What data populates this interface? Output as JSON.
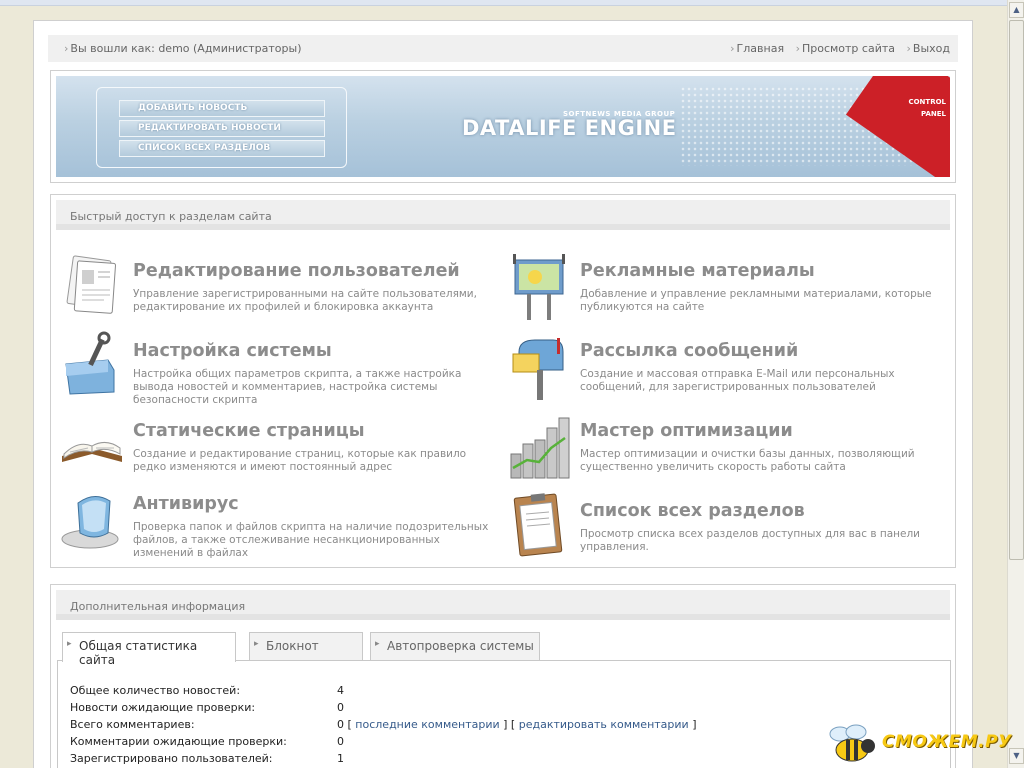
{
  "browser": {
    "scroll_up_icon": "arrow-up-icon",
    "scroll_down_icon": "arrow-down-icon"
  },
  "userbar": {
    "logged_in": "Вы вошли как: demo (Администраторы)",
    "links": [
      "Главная",
      "Просмотр сайта",
      "Выход"
    ]
  },
  "banner": {
    "menu": [
      "ДОБАВИТЬ НОВОСТЬ",
      "РЕДАКТИРОВАТЬ НОВОСТИ",
      "СПИСОК ВСЕХ РАЗДЕЛОВ"
    ],
    "group": "SOFTNEWS MEDIA GROUP",
    "brand": "DATALIFE ENGINE",
    "corner_line1": "CONTROL",
    "corner_line2": "PANEL"
  },
  "quick": {
    "heading": "Быстрый доступ к разделам сайта",
    "tiles": [
      {
        "title": "Редактирование пользователей",
        "desc": "Управление зарегистрированными на сайте пользователями, редактирование их профилей и блокировка аккаунта",
        "icon": "user-profile-icon"
      },
      {
        "title": "Рекламные материалы",
        "desc": "Добавление и управление рекламными материалами, которые публикуются на сайте",
        "icon": "billboard-icon"
      },
      {
        "title": "Настройка системы",
        "desc": "Настройка общих параметров скрипта, а также настройка вывода новостей и комментариев, настройка системы безопасности скрипта",
        "icon": "toolbox-icon"
      },
      {
        "title": "Рассылка сообщений",
        "desc": "Создание и массовая отправка E-Mail или персональных сообщений, для зарегистрированных пользователей",
        "icon": "mailbox-icon"
      },
      {
        "title": "Статические страницы",
        "desc": "Создание и редактирование страниц, которые как правило редко изменяются и имеют постоянный адрес",
        "icon": "open-book-icon"
      },
      {
        "title": "Мастер оптимизации",
        "desc": "Мастер оптимизации и очистки базы данных, позволяющий существенно увеличить скорость работы сайта",
        "icon": "bar-chart-icon"
      },
      {
        "title": "Антивирус",
        "desc": "Проверка папок и файлов скрипта на наличие подозрительных файлов, а также отслеживание несанкционированных изменений в файлах",
        "icon": "shield-icon"
      },
      {
        "title": "Список всех разделов",
        "desc": "Просмотр списка всех разделов доступных для вас в панели управления.",
        "icon": "clipboard-icon"
      }
    ]
  },
  "info": {
    "heading": "Дополнительная информация",
    "tabs": [
      "Общая статистика сайта",
      "Блокнот",
      "Автопроверка системы"
    ],
    "stats": [
      {
        "label": "Общее количество новостей:",
        "value": "4"
      },
      {
        "label": "Новости ожидающие проверки:",
        "value": "0"
      },
      {
        "label": "Всего комментариев:",
        "value": "0",
        "link1": "последние комментарии",
        "link2": "редактировать комментарии"
      },
      {
        "label": "Комментарии ожидающие проверки:",
        "value": "0"
      },
      {
        "label": "Зарегистрировано пользователей:",
        "value": "1"
      }
    ]
  },
  "watermark": {
    "text": "СМОЖЕМ.РУ",
    "icon": "bee-icon"
  },
  "colors": {
    "accent_red": "#cc2027",
    "link_blue": "#355a8a",
    "banner_blue": "#bad0e1"
  }
}
